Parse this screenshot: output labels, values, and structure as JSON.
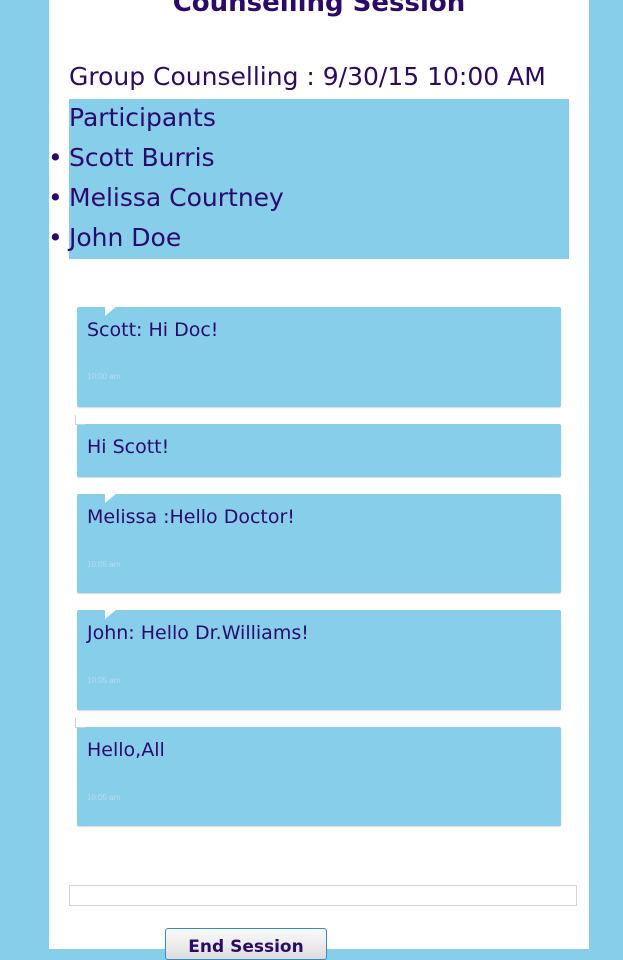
{
  "page_title": "Counselling Session",
  "session": {
    "line": "Group Counselling : 9/30/15 10:00 AM"
  },
  "participants": {
    "heading": "Participants",
    "names": [
      "Scott Burris",
      "Melissa Courtney",
      "John Doe"
    ]
  },
  "messages": [
    {
      "text": "Scott: Hi Doc!",
      "time": "10:00 am"
    },
    {
      "text": "Hi Scott!",
      "time": ""
    },
    {
      "text": "Melissa :Hello Doctor!",
      "time": "10:05 am"
    },
    {
      "text": "John: Hello Dr.Williams!",
      "time": "10:05 am"
    },
    {
      "text": "Hello,All",
      "time": "10:05 am"
    }
  ],
  "chat_input": {
    "value": "",
    "placeholder": ""
  },
  "end_session_label": "End Session"
}
